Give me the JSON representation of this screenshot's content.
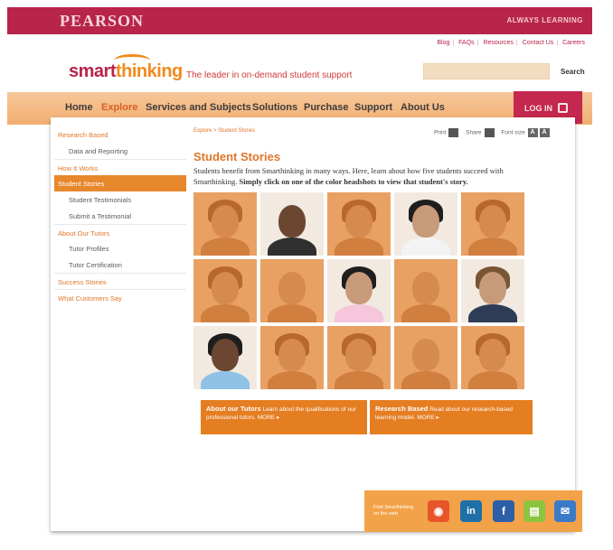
{
  "header": {
    "brand": "PEARSON",
    "tagline": "ALWAYS LEARNING",
    "utility_links": [
      "Blog",
      "FAQs",
      "Resources",
      "Contact Us",
      "Careers"
    ]
  },
  "logo": {
    "part1": "smart",
    "part2": "hinking",
    "slogan": "The leader in on-demand student support"
  },
  "search": {
    "placeholder": "",
    "button": "Search"
  },
  "nav": {
    "items": [
      "Home",
      "Explore",
      "Services and Subjects",
      "Solutions",
      "Purchase",
      "Support",
      "About Us"
    ],
    "active": "Explore",
    "login": "LOG IN"
  },
  "sidebar": {
    "items": [
      {
        "label": "Research Based",
        "level": "top"
      },
      {
        "label": "Data and Reporting",
        "level": "sub"
      },
      {
        "label": "How It Works",
        "level": "top"
      },
      {
        "label": "Student Stories",
        "level": "active"
      },
      {
        "label": "Student Testimonials",
        "level": "sub"
      },
      {
        "label": "Submit a Testimonial",
        "level": "sub"
      },
      {
        "label": "About Our Tutors",
        "level": "top"
      },
      {
        "label": "Tutor Profiles",
        "level": "sub"
      },
      {
        "label": "Tutor Certification",
        "level": "sub"
      },
      {
        "label": "Success Stories",
        "level": "top"
      },
      {
        "label": "What Customers Say",
        "level": "top"
      }
    ]
  },
  "content": {
    "breadcrumb": "Explore > Student Stories",
    "tools": {
      "print": "Print",
      "share": "Share",
      "font_size": "Font size",
      "font_a_small": "A",
      "font_a_large": "A"
    },
    "heading": "Student Stories",
    "intro_plain": "Students benefit from Smarthinking in many ways. Here, learn about how five students succeed with Smarthinking.",
    "intro_bold": "Simply click on one of the color headshots to view that student's story."
  },
  "promos": [
    {
      "title": "About our Tutors",
      "text": "Learn about the qualifications of our professional tutors. MORE ▸"
    },
    {
      "title": "Research Based",
      "text": "Read about our research-based learning model. MORE ▸"
    }
  ],
  "social": {
    "text_line1": "Find Smarthinking",
    "text_line2": "on the web",
    "icons": [
      "rss-icon",
      "linkedin-icon",
      "facebook-icon",
      "page-icon",
      "email-icon"
    ],
    "icon_colors": [
      "#e8552a",
      "#1f6fa8",
      "#2d5ea8",
      "#8cc43e",
      "#3a7bc8"
    ]
  },
  "colors": {
    "brand": "#b8244a",
    "accent": "#e8882c"
  }
}
